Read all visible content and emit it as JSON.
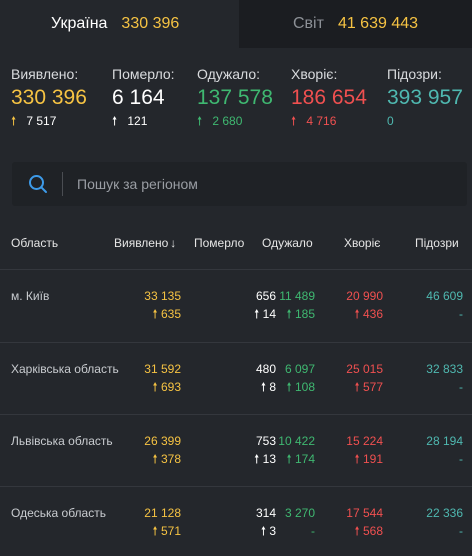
{
  "tabs": [
    {
      "label": "Україна",
      "value": "330 396"
    },
    {
      "label": "Світ",
      "value": "41 639 443"
    }
  ],
  "stats": [
    {
      "label": "Виявлено:",
      "value": "330 396",
      "delta": "7 517",
      "color": "#f6c343"
    },
    {
      "label": "Померло:",
      "value": "6 164",
      "delta": "121",
      "color": "#ffffff"
    },
    {
      "label": "Одужало:",
      "value": "137 578",
      "delta": "2 680",
      "color": "#3fb871"
    },
    {
      "label": "Хворіє:",
      "value": "186 654",
      "delta": "4 716",
      "color": "#f05050"
    },
    {
      "label": "Підозри:",
      "value": "393 957",
      "delta": "0",
      "color": "#4fb8b0"
    }
  ],
  "search": {
    "placeholder": "Пошук за регіоном"
  },
  "table": {
    "headers": {
      "region": "Область",
      "confirmed": "Виявлено",
      "deaths": "Померло",
      "recovered": "Одужало",
      "sick": "Хворіє",
      "suspected": "Підозри"
    },
    "rows": [
      {
        "name": "м. Київ",
        "confirmed": "33 135",
        "confirmed_delta": "635",
        "deaths": "656",
        "deaths_delta": "14",
        "recovered": "11 489",
        "recovered_delta": "185",
        "sick": "20 990",
        "sick_delta": "436",
        "suspected": "46 609",
        "suspected_delta": "-"
      },
      {
        "name": "Харківська область",
        "confirmed": "31 592",
        "confirmed_delta": "693",
        "deaths": "480",
        "deaths_delta": "8",
        "recovered": "6 097",
        "recovered_delta": "108",
        "sick": "25 015",
        "sick_delta": "577",
        "suspected": "32 833",
        "suspected_delta": "-"
      },
      {
        "name": "Львівська область",
        "confirmed": "26 399",
        "confirmed_delta": "378",
        "deaths": "753",
        "deaths_delta": "13",
        "recovered": "10 422",
        "recovered_delta": "174",
        "sick": "15 224",
        "sick_delta": "191",
        "suspected": "28 194",
        "suspected_delta": "-"
      },
      {
        "name": "Одеська область",
        "confirmed": "21 128",
        "confirmed_delta": "571",
        "deaths": "314",
        "deaths_delta": "3",
        "recovered": "3 270",
        "recovered_delta": "-",
        "sick": "17 544",
        "sick_delta": "568",
        "suspected": "22 336",
        "suspected_delta": "-"
      }
    ]
  },
  "colors": {
    "confirmed": "#f6c343",
    "deaths": "#ffffff",
    "recovered": "#3fb871",
    "sick": "#f05050",
    "suspected": "#4fb8b0"
  }
}
